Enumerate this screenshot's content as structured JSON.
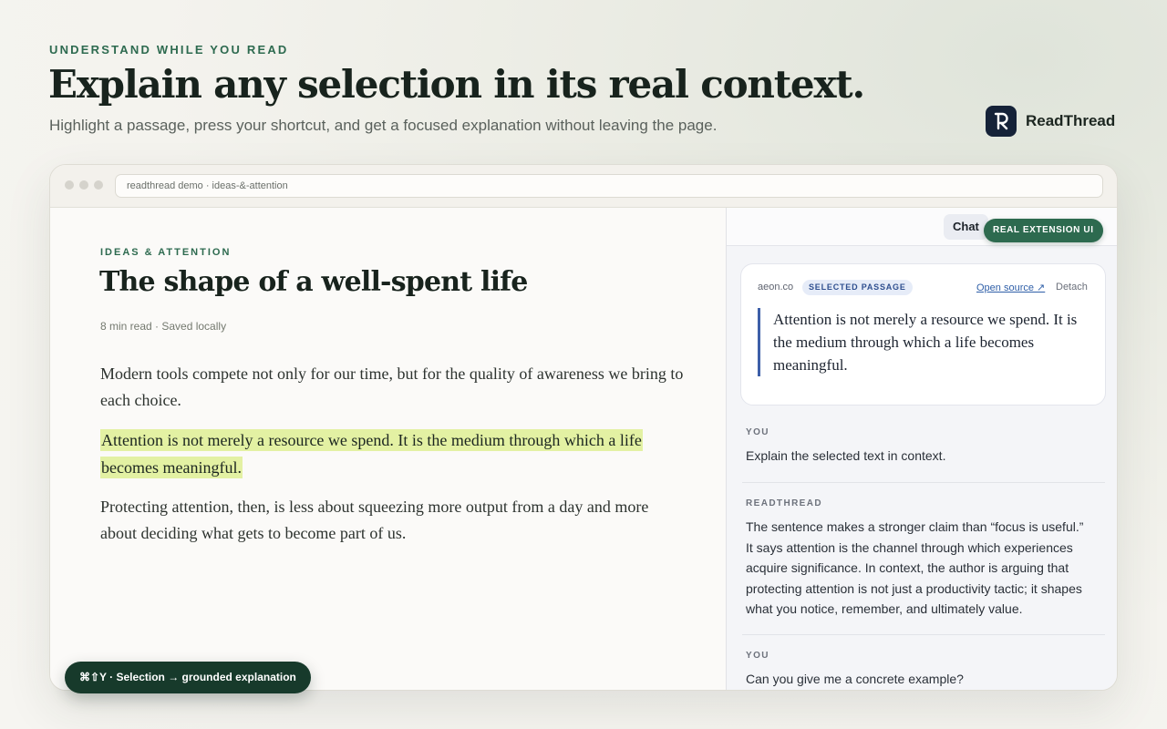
{
  "hero": {
    "eyebrow": "UNDERSTAND WHILE YOU READ",
    "headline": "Explain any selection in its real context.",
    "subline": "Highlight a passage, press your shortcut, and get a focused explanation without leaving the page."
  },
  "brand": {
    "name": "ReadThread",
    "logo_letter": "R",
    "logo_icon": "readthread-logo-icon"
  },
  "browser": {
    "url": "readthread demo · ideas-&-attention"
  },
  "article": {
    "kicker": "IDEAS & ATTENTION",
    "title": "The shape of a well-spent life",
    "meta": "8 min read · Saved locally",
    "paragraphs": [
      "Modern tools compete not only for our time, but for the quality of awareness we bring to each choice.",
      "Attention is not merely a resource we spend. It is the medium through which a life becomes meaningful.",
      "Protecting attention, then, is less about squeezing more output from a day and more about deciding what gets to become part of us."
    ]
  },
  "shortcut_pill": "⌘⇧Y · Selection → grounded explanation",
  "panel": {
    "tab_chat": "Chat",
    "badge": "REAL EXTENSION UI",
    "card": {
      "source": "aeon.co",
      "chip": "SELECTED PASSAGE",
      "open_source": "Open source ↗",
      "detach": "Detach",
      "quote": "Attention is not merely a resource we spend. It is the medium through which a life becomes meaningful."
    },
    "messages": [
      {
        "role": "YOU",
        "text": "Explain the selected text in context."
      },
      {
        "role": "READTHREAD",
        "text": "The sentence makes a stronger claim than “focus is useful.” It says attention is the channel through which experiences acquire significance. In context, the author is arguing that protecting attention is not just a productivity tactic; it shapes what you notice, remember, and ultimately value."
      },
      {
        "role": "YOU",
        "text": "Can you give me a concrete example?"
      }
    ]
  },
  "colors": {
    "accent_green": "#2d6a4f",
    "highlight": "#e3f1a3",
    "quote_bar": "#3d5fa8",
    "logo_bg": "#152238"
  }
}
